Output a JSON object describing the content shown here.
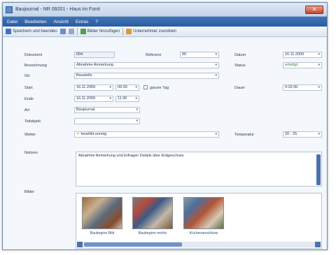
{
  "window": {
    "title": "Baujournal - NR 09201 - Haus im Forst",
    "close_glyph": "✕"
  },
  "menu": [
    "Datei",
    "Bearbeiten",
    "Ansicht",
    "Extras",
    "?"
  ],
  "toolbar": {
    "save_close": "Speichern und beenden",
    "attach_image": "Bilder hinzufügen",
    "subcontractor": "Unternehmer zuordnen"
  },
  "form": {
    "dokument_label": "Dokument",
    "dokument_value": "004",
    "referenz_label": "Referenz",
    "referenz_value": "90",
    "datum_label": "Datum",
    "datum_value": "16.11.2009",
    "bezeichnung_label": "Bezeichnung",
    "bezeichnung_value": "Abnahme Anmerkung",
    "status_label": "Status",
    "status_value": "erledigt",
    "ort_label": "Ort",
    "ort_value": "Baustelle",
    "start_label": "Start",
    "start_date": "16.11.2009",
    "start_time": "09:30",
    "ganzer_tag_label": "ganzer Tag",
    "dauer_label": "Dauer",
    "dauer_value": "0:02:00",
    "ende_label": "Ende",
    "ende_date": "16.11.2009",
    "ende_time": "11:30",
    "art_label": "Art",
    "art_value": "Baujournal",
    "teilobjekt_label": "Teilobjekt",
    "teilobjekt_value": "",
    "wetter_label": "Wetter",
    "wetter_value": "bewölkt-sonnig",
    "temperatur_label": "Temperatur",
    "temperatur_value": "20 - 25",
    "notizen_label": "Notizen",
    "notizen_value": "Abnahme Anmerkung und Erfragen Details über Erdgeschoss",
    "bilder_label": "Bilder"
  },
  "images": [
    {
      "caption": "Baubeginn Bild"
    },
    {
      "caption": "Baubeginn rechts"
    },
    {
      "caption": "Küchenanschluss"
    }
  ],
  "colors": {
    "accent": "#2a5c9f",
    "status_ok": "#2f8a2f"
  }
}
